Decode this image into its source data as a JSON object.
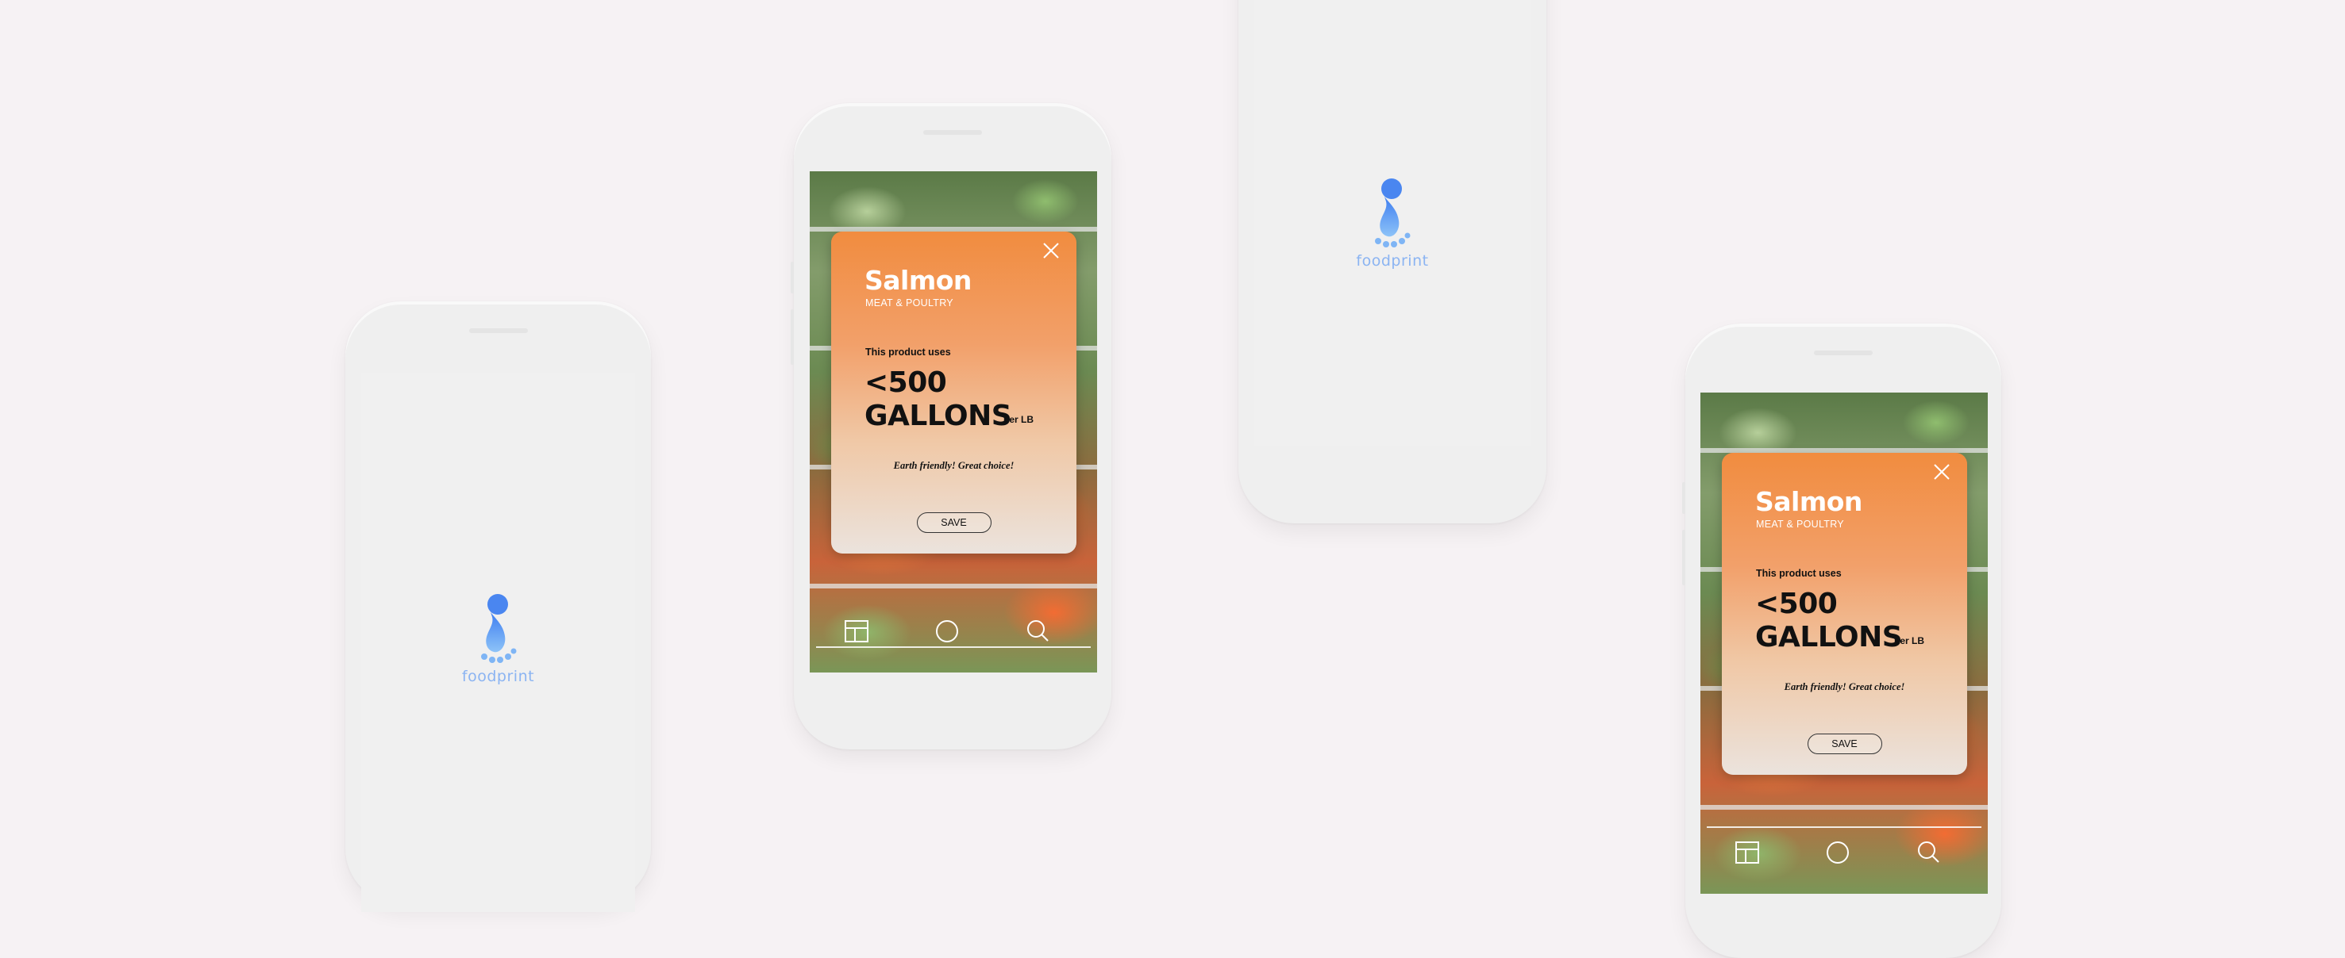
{
  "app": {
    "name": "foodprint",
    "colors": {
      "background": "#f6f2f4",
      "phone": "#efefef",
      "brand_blue": "#5b8def",
      "brand_text": "#8bb4f2",
      "card_top": "#f18c3f",
      "card_bottom": "#ebe3dd"
    }
  },
  "splash_left": {
    "logo_text": "foodprint",
    "icon": "foot-drop-icon"
  },
  "splash_top": {
    "logo_text": "foodprint",
    "icon": "foot-drop-icon"
  },
  "product_card_center": {
    "name": "Salmon",
    "category": "MEAT & POULTRY",
    "uses_label": "This product uses",
    "amount_line1": "<500",
    "amount_line2": "GALLONS",
    "unit": "per LB",
    "verdict": "Earth friendly! Great choice!",
    "save_label": "SAVE",
    "close_icon": "close-icon"
  },
  "product_card_right": {
    "name": "Salmon",
    "category": "MEAT & POULTRY",
    "uses_label": "This product uses",
    "amount_line1": "<500",
    "amount_line2": "GALLONS",
    "unit": "per LB",
    "verdict": "Earth friendly! Great choice!",
    "save_label": "SAVE",
    "close_icon": "close-icon"
  },
  "tabbar": {
    "icons": [
      "scan-frame-icon",
      "shutter-icon",
      "search-icon"
    ]
  }
}
